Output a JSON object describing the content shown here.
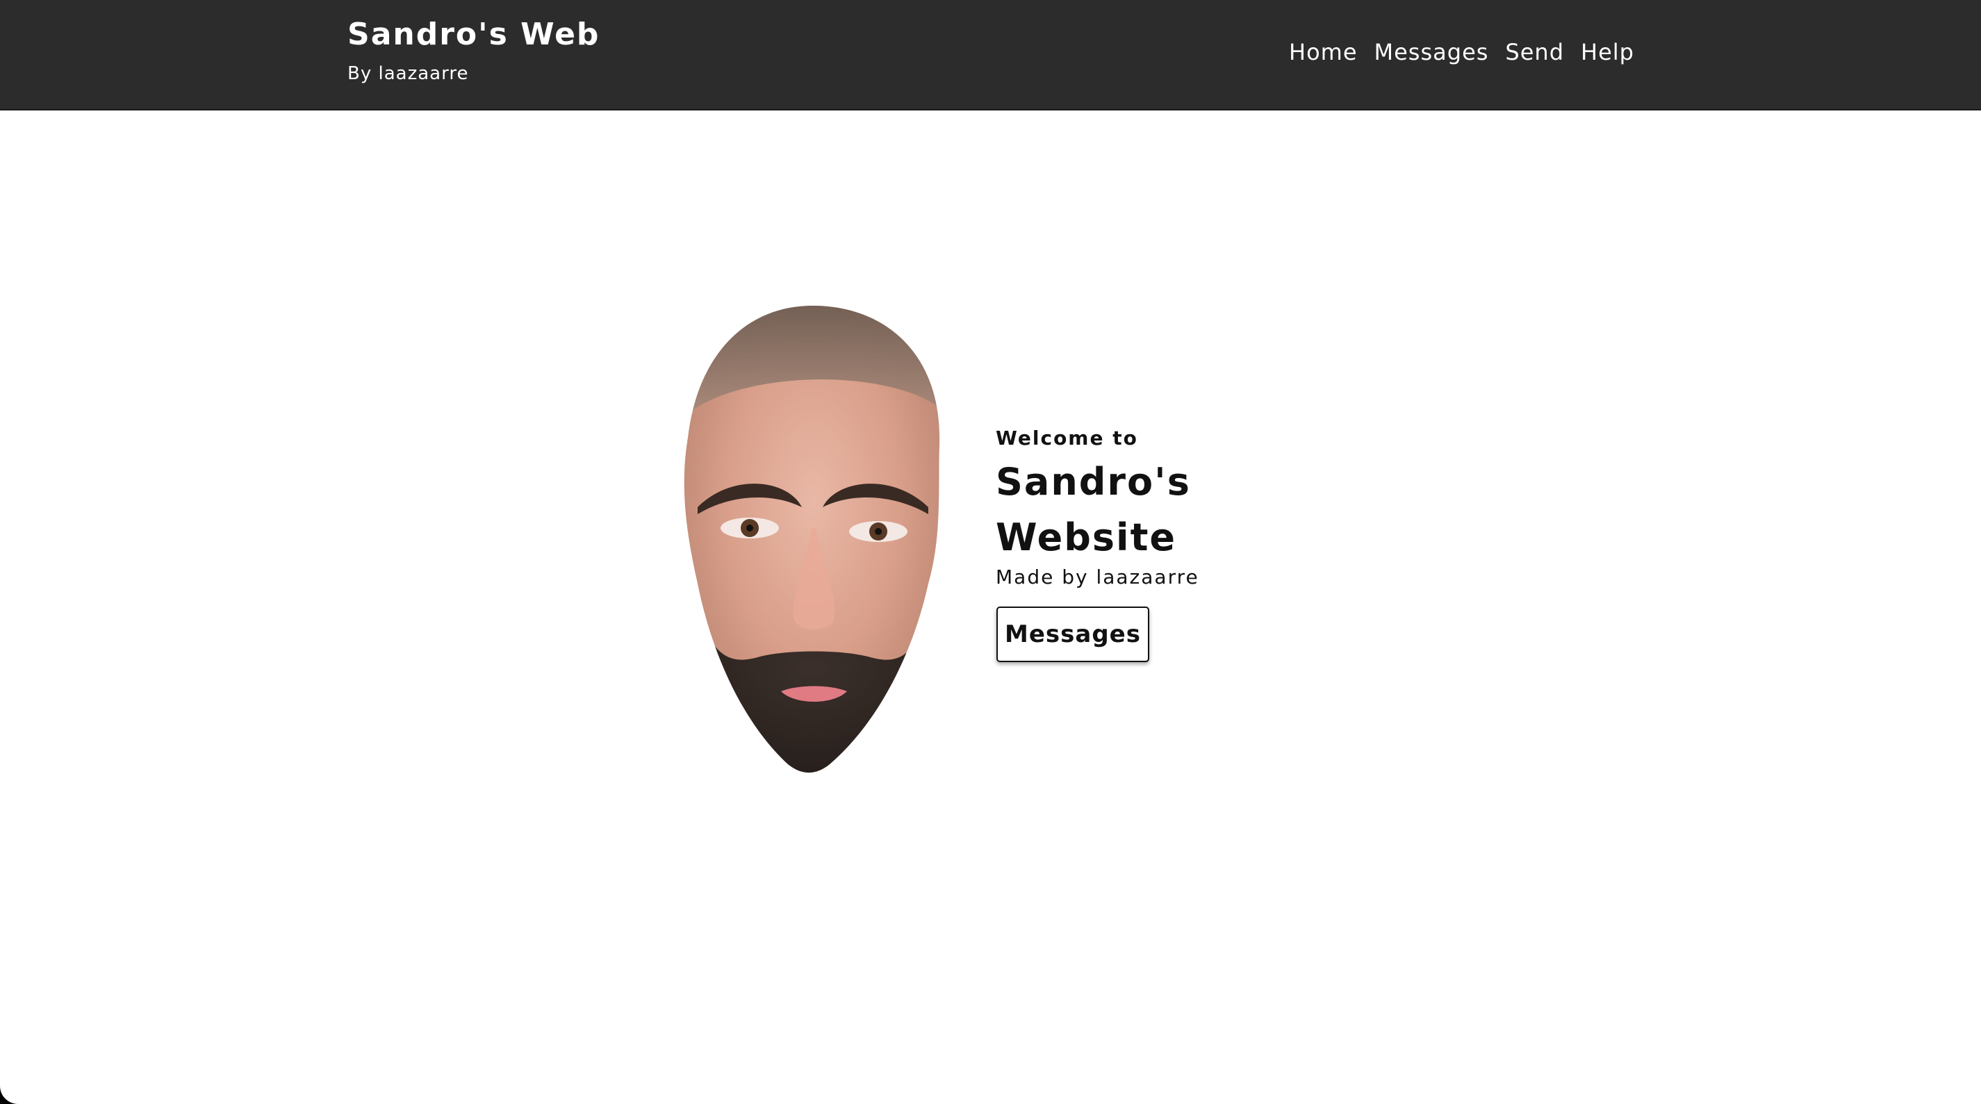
{
  "header": {
    "title": "Sandro's Web",
    "subtitle": "By laazaarre",
    "nav": [
      "Home",
      "Messages",
      "Send",
      "Help"
    ]
  },
  "hero": {
    "welcome": "Welcome to",
    "title_line1": "Sandro's",
    "title_line2": "Website",
    "made_by": "Made by laazaarre",
    "button": "Messages"
  },
  "colors": {
    "topbar": "#2c2c2c",
    "background": "#ffffff",
    "text": "#111111"
  },
  "icons": {
    "face_image": "face-photo"
  }
}
